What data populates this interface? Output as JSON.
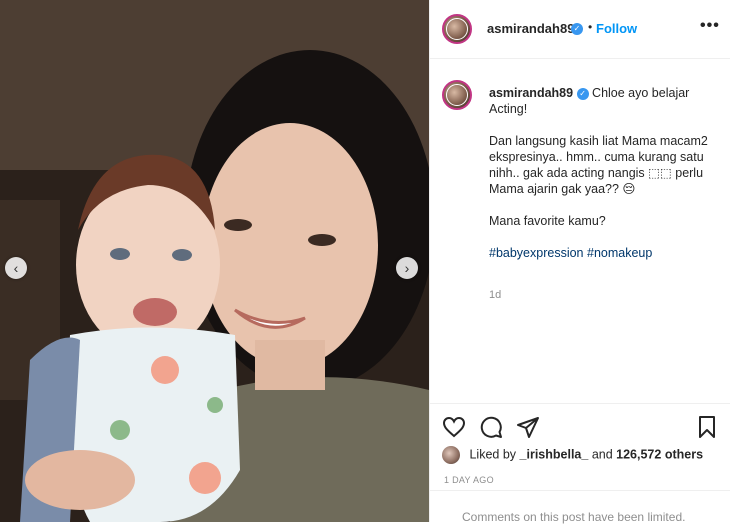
{
  "post": {
    "username": "asmirandah89",
    "follow_label": "Follow",
    "separator": "•",
    "more_label": "•••",
    "verified_mark": "✓"
  },
  "caption": {
    "username": "asmirandah89",
    "lines": [
      "Chloe ayo belajar Acting!",
      "Dan langsung kasih liat Mama macam2 ekspresinya.. hmm.. cuma kurang satu nihh.. gak ada acting nangis ⬚⬚ perlu Mama ajarin gak yaa?? 😔",
      "Mana favorite kamu?"
    ],
    "hashtag_1": "#babyexpression",
    "hashtag_2": "#nomakeup",
    "time_ago": "1d"
  },
  "likes": {
    "prefix": "Liked by",
    "user": "_irishbella_",
    "middle": "and",
    "count": "126,572 others"
  },
  "date": "1 DAY AGO",
  "comments_notice": "Comments on this post have been limited.",
  "icons": {
    "heart": "heart-icon",
    "comment": "comment-icon",
    "share": "paper-plane-icon",
    "save": "bookmark-icon",
    "prev": "chevron-left-icon",
    "next": "chevron-right-icon"
  },
  "colors": {
    "accent": "#0095f6",
    "verified": "#3897f0",
    "hashtag": "#00376b",
    "muted": "#8e8e8e"
  }
}
